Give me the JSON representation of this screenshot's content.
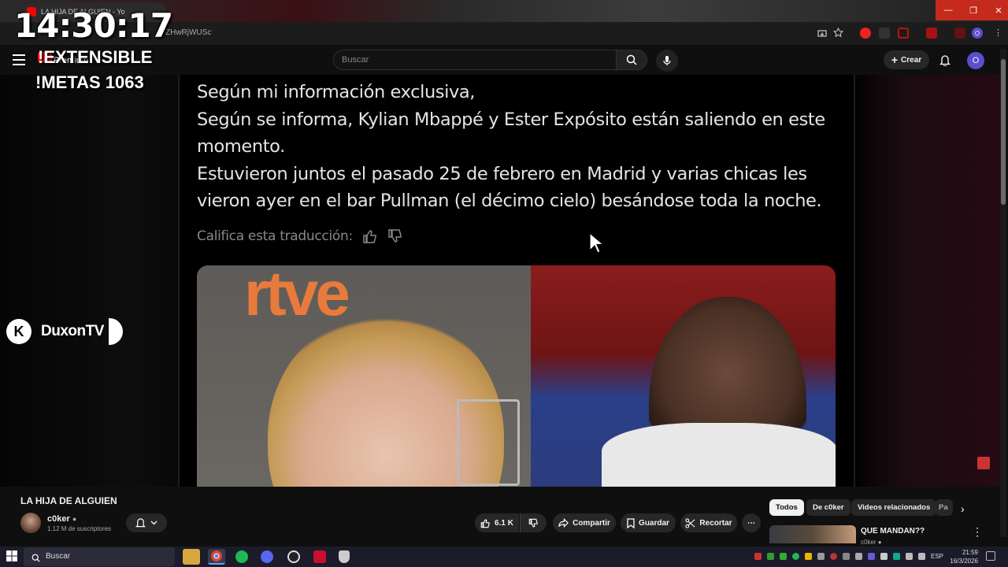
{
  "browser": {
    "tab_title": "LA HIJA DE ALGUIEN - Yo",
    "url_fragment": "ZHwRjWUSc",
    "profile_initial": "O",
    "window_buttons": {
      "minimize": "—",
      "maximize": "❐",
      "close": "✕"
    }
  },
  "overlay": {
    "clock": "14:30:17",
    "line1": "!EXTENSIBLE",
    "line2": "!METAS 1063",
    "badge_name": "DuxonTV",
    "badge_letter": "K"
  },
  "youtube_header": {
    "logo_text": "Premium",
    "search_placeholder": "Buscar",
    "create_label": "Crear",
    "avatar_initial": "O"
  },
  "video_content": {
    "lines": [
      "Según mi información exclusiva,",
      "Según se informa, Kylian Mbappé y Ester Expósito están saliendo en este momento.",
      "Estuvieron juntos el pasado 25 de febrero en Madrid y varias chicas les vieron ayer en el bar Pullman (el décimo cielo) besándose toda la noche."
    ],
    "rate_label": "Califica esta traducción:",
    "photo_left_logo": "rtve"
  },
  "video_info": {
    "title": "LA HIJA DE ALGUIEN",
    "channel_name": "c0ker",
    "subscribers": "1.12 M de suscriptores",
    "likes": "6.1 K",
    "share_label": "Compartir",
    "save_label": "Guardar",
    "clip_label": "Recortar"
  },
  "sidebar": {
    "chips": [
      "Todos",
      "De c0ker",
      "Videos relacionados",
      "Pa"
    ],
    "rec_title": "QUE MANDAN??",
    "rec_channel": "c0ker"
  },
  "taskbar": {
    "search_label": "Buscar",
    "language": "ESP",
    "time": "21:59",
    "date": "16/3/2026"
  }
}
